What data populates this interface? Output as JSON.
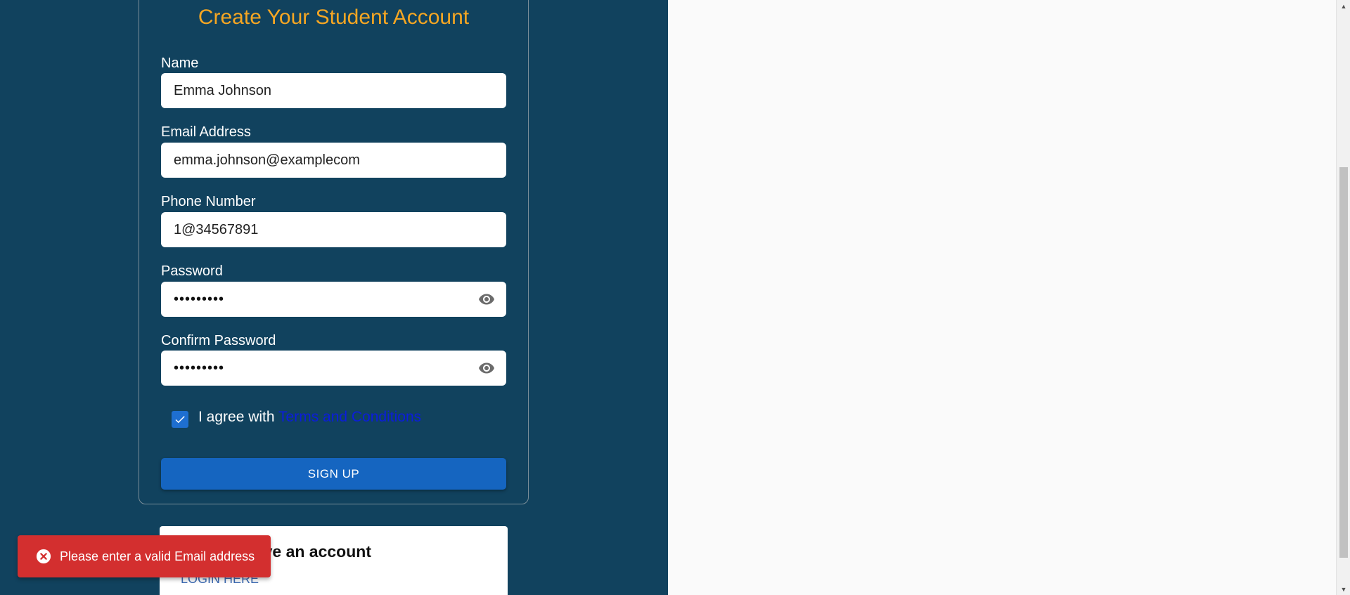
{
  "form": {
    "title": "Create Your Student Account",
    "fields": {
      "name": {
        "label": "Name",
        "value": "Emma Johnson"
      },
      "email": {
        "label": "Email Address",
        "value": "emma.johnson@examplecom"
      },
      "phone": {
        "label": "Phone Number",
        "value": "1@34567891"
      },
      "password": {
        "label": "Password",
        "value": "•••••••••"
      },
      "confirm_password": {
        "label": "Confirm Password",
        "value": "•••••••••"
      }
    },
    "agree": {
      "prefix": "I agree with",
      "link": "Terms and Conditions",
      "checked": true
    },
    "submit_label": "SIGN UP"
  },
  "login_card": {
    "heading": "Already have an account",
    "link": "LOGIN HERE"
  },
  "toast": {
    "message": "Please enter a valid Email address"
  },
  "colors": {
    "panel_bg": "#11425e",
    "title": "#f5a623",
    "primary": "#1565c0",
    "error": "#d32f2f",
    "link": "#0b1cdd"
  }
}
